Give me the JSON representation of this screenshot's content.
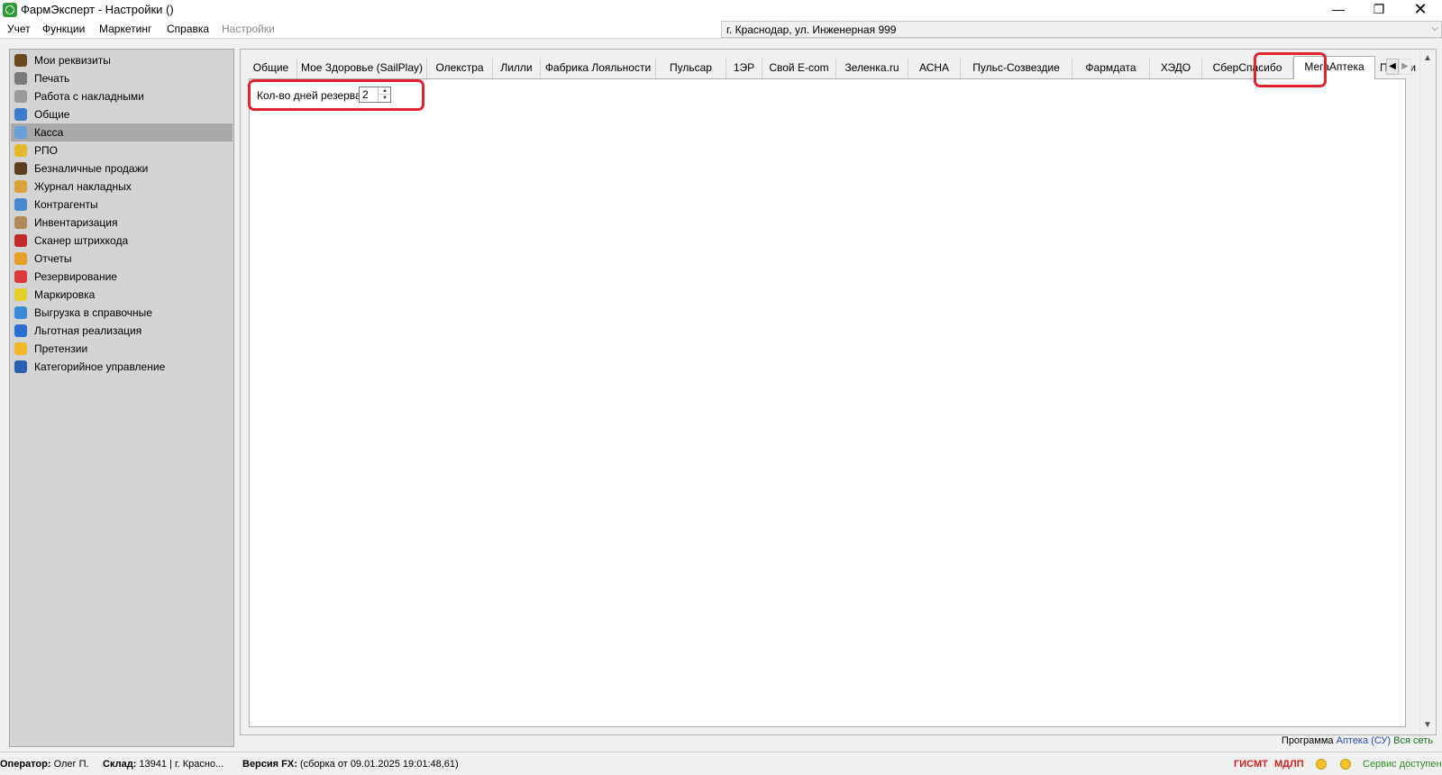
{
  "window": {
    "title": "ФармЭксперт - Настройки ()",
    "controls": {
      "minimize": "—",
      "restore": "❐",
      "close": "✕"
    }
  },
  "menu": {
    "items": [
      "Учет",
      "Функции",
      "Маркетинг",
      "Справка",
      "Настройки"
    ],
    "address": "г. Краснодар, ул. Инженерная 999",
    "address_arrow": "⌵"
  },
  "sidebar": {
    "items": [
      {
        "label": "Мои реквизиты",
        "icon": "person-icon",
        "color": "#6b4a22"
      },
      {
        "label": "Печать",
        "icon": "printer-icon",
        "color": "#7a7a7a"
      },
      {
        "label": "Работа с накладными",
        "icon": "document-icon",
        "color": "#9a9a9a"
      },
      {
        "label": "Общие",
        "icon": "general-icon",
        "color": "#3d7cc9"
      },
      {
        "label": "Касса",
        "icon": "cash-register-icon",
        "color": "#6aa0d6",
        "selected": true
      },
      {
        "label": "РПО",
        "icon": "rpo-icon",
        "color": "#e6b82e"
      },
      {
        "label": "Безналичные продажи",
        "icon": "card-payment-icon",
        "color": "#5a4020"
      },
      {
        "label": "Журнал накладных",
        "icon": "journal-icon",
        "color": "#d9a43a"
      },
      {
        "label": "Контрагенты",
        "icon": "contractors-icon",
        "color": "#4a88d0"
      },
      {
        "label": "Инвентаризация",
        "icon": "inventory-icon",
        "color": "#b08a5a"
      },
      {
        "label": "Сканер штрихкода",
        "icon": "barcode-icon",
        "color": "#c02a2a"
      },
      {
        "label": "Отчеты",
        "icon": "reports-icon",
        "color": "#e6a02a"
      },
      {
        "label": "Резервирование",
        "icon": "reserve-icon",
        "color": "#d93a3a"
      },
      {
        "label": "Маркировка",
        "icon": "marking-icon",
        "color": "#e6cf2a"
      },
      {
        "label": "Выгрузка в справочные",
        "icon": "export-icon",
        "color": "#3a8bd6"
      },
      {
        "label": "Льготная реализация",
        "icon": "benefit-icon",
        "color": "#2a6fd0"
      },
      {
        "label": "Претензии",
        "icon": "claims-icon",
        "color": "#f0b82a"
      },
      {
        "label": "Категорийное управление",
        "icon": "category-icon",
        "color": "#2a5fb0"
      }
    ]
  },
  "tabs": [
    {
      "label": "Общие"
    },
    {
      "label": "Мое Здоровье (SailPlay)"
    },
    {
      "label": "Олекстра"
    },
    {
      "label": "Лилли"
    },
    {
      "label": "Фабрика Лояльности"
    },
    {
      "label": "Пульсар"
    },
    {
      "label": "1ЭР"
    },
    {
      "label": "Свой E-com"
    },
    {
      "label": "Зеленка.ru"
    },
    {
      "label": "АСНА"
    },
    {
      "label": "Пульс-Созвездие"
    },
    {
      "label": "Фармдата"
    },
    {
      "label": "ХЭДО"
    },
    {
      "label": "СберСпасибо"
    },
    {
      "label": "МегаАптека",
      "active": true
    },
    {
      "label": "Прокси"
    }
  ],
  "tab_scroll": {
    "left": "◀",
    "right": "▶"
  },
  "scrollbar": {
    "up": "▲",
    "down": "▼"
  },
  "megaapteka": {
    "reserve_days_label": "Кол-во дней резерва",
    "reserve_days_value": "2",
    "spin_up": "▲",
    "spin_down": "▼"
  },
  "program": {
    "prefix": "Программа",
    "name": "Аптека (СУ)",
    "network": "Вся сеть"
  },
  "statusbar": {
    "operator_label": "Оператор:",
    "operator_value": "Олег П.",
    "warehouse_label": "Склад:",
    "warehouse_value": "13941 | г. Красно...",
    "version_label": "Версия FX:",
    "version_value": "(сборка от 09.01.2025 19:01:48,61)",
    "gismt": "ГИСМТ",
    "mdlp": "МДЛП",
    "service": "Сервис доступен"
  }
}
